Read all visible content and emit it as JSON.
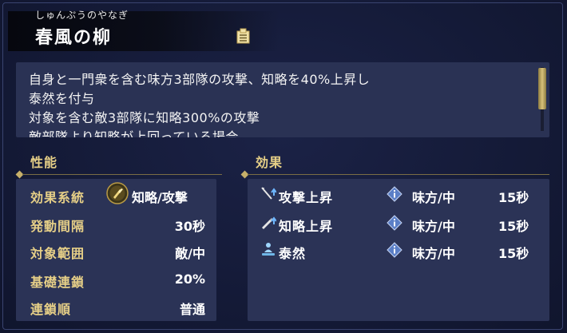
{
  "header": {
    "furigana": "しゅんぷうのやなぎ",
    "title": "春風の柳"
  },
  "description": {
    "lines": [
      "自身と一門衆を含む味方3部隊の攻撃、知略を40%上昇し",
      "泰然を付与",
      "対象を含む敵3部隊に知略300%の攻撃",
      "敵部隊より知略が上回っている場合"
    ]
  },
  "performance": {
    "heading": "性能",
    "rows": [
      {
        "label": "効果系統",
        "value": "知略/攻撃",
        "icon": "strategy-type-icon"
      },
      {
        "label": "発動間隔",
        "value": "30秒"
      },
      {
        "label": "対象範囲",
        "value": "敵/中"
      },
      {
        "label": "基礎連鎖",
        "value": "20%"
      },
      {
        "label": "連鎖順",
        "value": "普通"
      }
    ]
  },
  "effects": {
    "heading": "効果",
    "rows": [
      {
        "name": "攻撃上昇",
        "target": "味方/中",
        "duration": "15秒",
        "icon": "attack-up-icon"
      },
      {
        "name": "知略上昇",
        "target": "味方/中",
        "duration": "15秒",
        "icon": "intellect-up-icon"
      },
      {
        "name": "泰然",
        "target": "味方/中",
        "duration": "15秒",
        "icon": "composure-icon"
      }
    ]
  },
  "colors": {
    "accent_gold": "#e6cf87",
    "panel": "#2b3356",
    "background": "#141a37"
  }
}
